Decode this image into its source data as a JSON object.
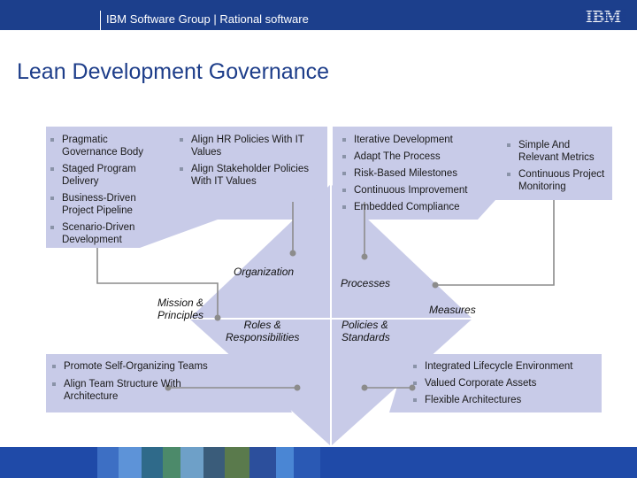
{
  "header": {
    "text": "IBM Software Group | Rational software",
    "logo_text": "IBM"
  },
  "title": "Lean Development Governance",
  "colors": {
    "header_bg": "#1c3f8c",
    "title": "#1e3e8a",
    "diagram_fill": "#c8cbe8",
    "connector": "#8c8c8c",
    "footer_bg": "#1f4aa8"
  },
  "lists": {
    "mission": [
      "Pragmatic Governance Body",
      "Staged Program Delivery",
      "Business-Driven Project Pipeline",
      "Scenario-Driven Development"
    ],
    "organization": [
      "Align HR Policies With IT Values",
      "Align Stakeholder Policies With IT Values"
    ],
    "processes": [
      "Iterative Development",
      "Adapt The Process",
      "Risk-Based Milestones",
      "Continuous Improvement",
      "Embedded Compliance"
    ],
    "measures": [
      "Simple And Relevant Metrics",
      "Continuous Project Monitoring"
    ],
    "roles": [
      "Promote Self-Organizing Teams",
      "Align Team Structure With Architecture"
    ],
    "policies": [
      "Integrated Lifecycle Environment",
      "Valued Corporate Assets",
      "Flexible Architectures"
    ]
  },
  "labels": {
    "organization": "Organization",
    "processes": "Processes",
    "mission_line1": "Mission &",
    "mission_line2": "Principles",
    "measures": "Measures",
    "roles_line1": "Roles &",
    "roles_line2": "Responsibilities",
    "policies_line1": "Policies &",
    "policies_line2": "Standards"
  }
}
